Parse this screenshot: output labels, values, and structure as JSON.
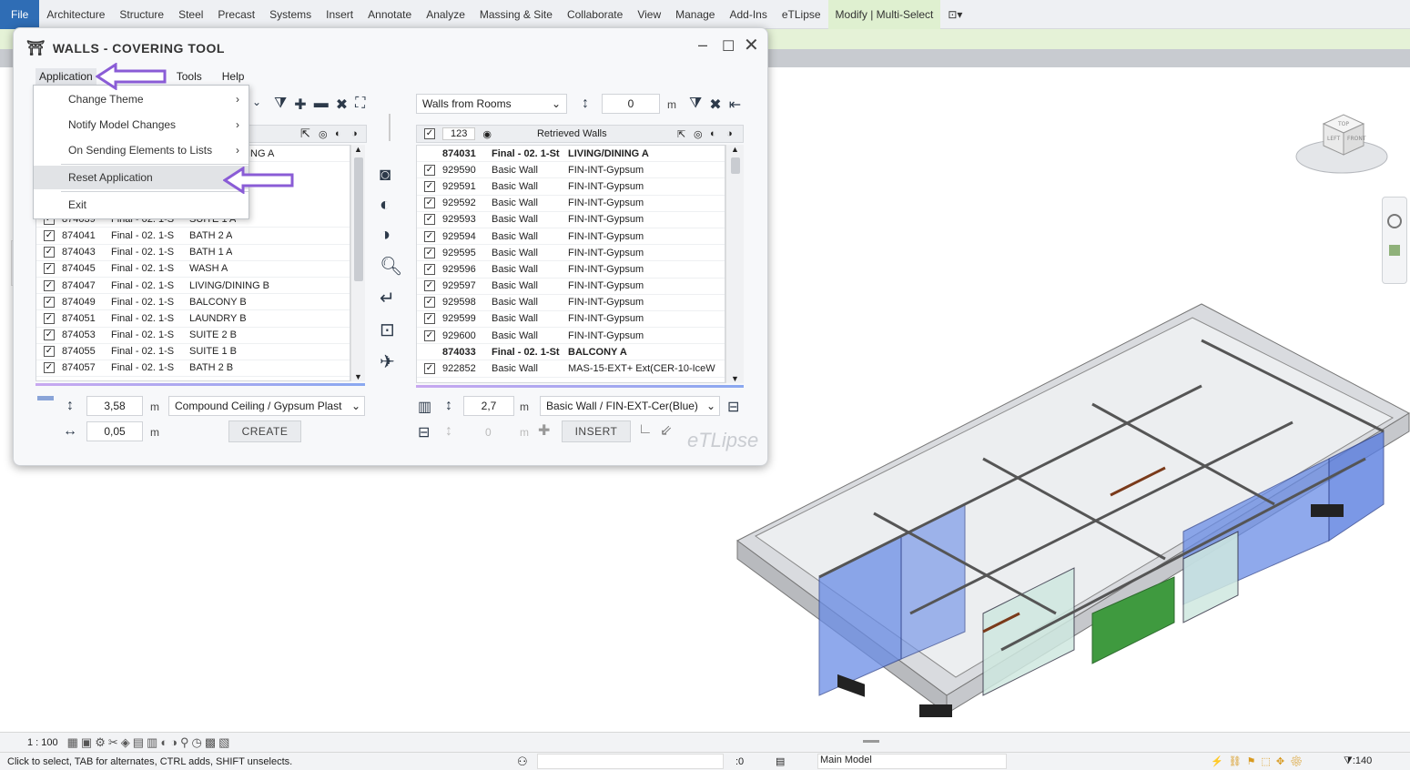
{
  "ribbon": {
    "tabs": [
      "File",
      "Architecture",
      "Structure",
      "Steel",
      "Precast",
      "Systems",
      "Insert",
      "Annotate",
      "Analyze",
      "Massing & Site",
      "Collaborate",
      "View",
      "Manage",
      "Add-Ins",
      "eTLipse",
      "Modify | Multi-Select"
    ]
  },
  "dialog": {
    "title": "WALLS - COVERING TOOL",
    "menu": [
      "Application",
      "Tools",
      "Help"
    ],
    "dropdown": {
      "items": [
        "Change Theme",
        "Notify Model Changes",
        "On Sending Elements to Lists",
        "Reset Application",
        "Exit"
      ]
    },
    "left_list": {
      "partial_header": "ING A",
      "rows": [
        {
          "id": "874039",
          "level": "Final - 02. 1-S",
          "room": "SUITE 1 A"
        },
        {
          "id": "874041",
          "level": "Final - 02. 1-S",
          "room": "BATH 2 A"
        },
        {
          "id": "874043",
          "level": "Final - 02. 1-S",
          "room": "BATH 1 A"
        },
        {
          "id": "874045",
          "level": "Final - 02. 1-S",
          "room": "WASH A"
        },
        {
          "id": "874047",
          "level": "Final - 02. 1-S",
          "room": "LIVING/DINING B"
        },
        {
          "id": "874049",
          "level": "Final - 02. 1-S",
          "room": "BALCONY B"
        },
        {
          "id": "874051",
          "level": "Final - 02. 1-S",
          "room": "LAUNDRY B"
        },
        {
          "id": "874053",
          "level": "Final - 02. 1-S",
          "room": "SUITE 2 B"
        },
        {
          "id": "874055",
          "level": "Final - 02. 1-S",
          "room": "SUITE 1 B"
        },
        {
          "id": "874057",
          "level": "Final - 02. 1-S",
          "room": "BATH 2 B"
        }
      ]
    },
    "right_panel": {
      "source_select": "Walls from Rooms",
      "offset_value": "0",
      "unit": "m",
      "header_count": "123",
      "header_title": "Retrieved Walls",
      "rows": [
        {
          "group": true,
          "id": "874031",
          "level": "Final - 02. 1-St",
          "room": "LIVING/DINING A"
        },
        {
          "id": "929590",
          "type": "Basic Wall",
          "name": "FIN-INT-Gypsum"
        },
        {
          "id": "929591",
          "type": "Basic Wall",
          "name": "FIN-INT-Gypsum"
        },
        {
          "id": "929592",
          "type": "Basic Wall",
          "name": "FIN-INT-Gypsum"
        },
        {
          "id": "929593",
          "type": "Basic Wall",
          "name": "FIN-INT-Gypsum"
        },
        {
          "id": "929594",
          "type": "Basic Wall",
          "name": "FIN-INT-Gypsum"
        },
        {
          "id": "929595",
          "type": "Basic Wall",
          "name": "FIN-INT-Gypsum"
        },
        {
          "id": "929596",
          "type": "Basic Wall",
          "name": "FIN-INT-Gypsum"
        },
        {
          "id": "929597",
          "type": "Basic Wall",
          "name": "FIN-INT-Gypsum"
        },
        {
          "id": "929598",
          "type": "Basic Wall",
          "name": "FIN-INT-Gypsum"
        },
        {
          "id": "929599",
          "type": "Basic Wall",
          "name": "FIN-INT-Gypsum"
        },
        {
          "id": "929600",
          "type": "Basic Wall",
          "name": "FIN-INT-Gypsum"
        },
        {
          "group": true,
          "id": "874033",
          "level": "Final - 02. 1-St",
          "room": "BALCONY A"
        },
        {
          "id": "922852",
          "type": "Basic Wall",
          "name": "MAS-15-EXT+ Ext(CER-10-IceW"
        }
      ]
    },
    "bottom_left": {
      "height_value": "3,58",
      "height_unit": "m",
      "ceiling_type": "Compound Ceiling / Gypsum Plast",
      "offset_value": "0,05",
      "offset_unit": "m",
      "create_label": "CREATE"
    },
    "bottom_right": {
      "height_value": "2,7",
      "height_unit": "m",
      "wall_type": "Basic Wall / FIN-EXT-Cer(Blue)",
      "offset_value": "0",
      "offset_unit": "m",
      "insert_label": "INSERT",
      "brand": "eTLipse"
    }
  },
  "statusbar": {
    "scale": "1 : 100",
    "hint": "Click to select, TAB for alternates, CTRL adds, SHIFT unselects.",
    "selection_count": ":0",
    "model": "Main Model",
    "filter_count": ":140"
  },
  "viewcube": {
    "faces": [
      "TOP",
      "LEFT",
      "FRONT"
    ]
  },
  "colors": {
    "accent_purple": "#8a5cd6",
    "file_tab": "#2f6db5",
    "glass_blue": "#5b7fe0"
  }
}
